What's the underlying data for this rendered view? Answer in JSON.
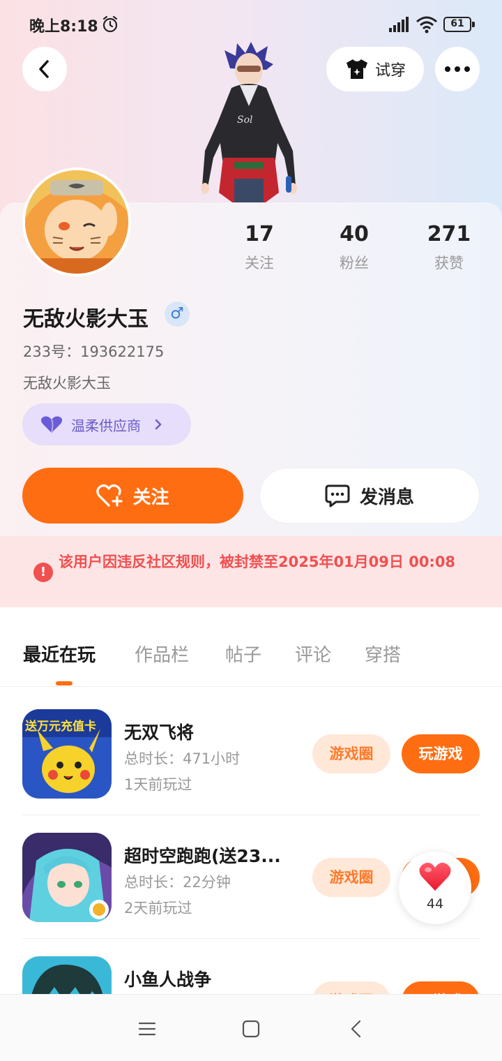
{
  "status_bar": {
    "time": "晚上8:18",
    "battery": "61"
  },
  "top_bar": {
    "tryon_label": "试穿"
  },
  "profile": {
    "stats": [
      {
        "value": "17",
        "label": "关注"
      },
      {
        "value": "40",
        "label": "粉丝"
      },
      {
        "value": "271",
        "label": "获赞"
      }
    ],
    "nickname": "无敌火影大玉",
    "gender_symbol": "♂",
    "uid": "233号：193622175",
    "bio": "无敌火影大玉",
    "tag": "温柔供应商"
  },
  "actions": {
    "follow_label": "关注",
    "message_label": "发消息"
  },
  "ban_notice": {
    "text": "该用户因违反社区规则，被封禁至2025年01月09日 00:08"
  },
  "tabs": [
    "最近在玩",
    "作品栏",
    "帖子",
    "评论",
    "穿搭"
  ],
  "games": [
    {
      "name": "无双飞将",
      "duration": "总时长：471小时",
      "last_played": "1天前玩过",
      "icon_text": "送万元充值卡",
      "circle_label": "游戏圈",
      "play_label": "玩游戏"
    },
    {
      "name": "超时空跑跑(送23...",
      "duration": "总时长：22分钟",
      "last_played": "2天前玩过",
      "circle_label": "游戏圈",
      "play_label": "玩游戏"
    },
    {
      "name": "小鱼人战争",
      "circle_label": "游戏圈",
      "play_label": "玩游戏"
    }
  ],
  "like_float": {
    "count": "44"
  },
  "colors": {
    "accent": "#ff6d12",
    "ban_text": "#f05050",
    "tag_bg": "#e6defa"
  }
}
